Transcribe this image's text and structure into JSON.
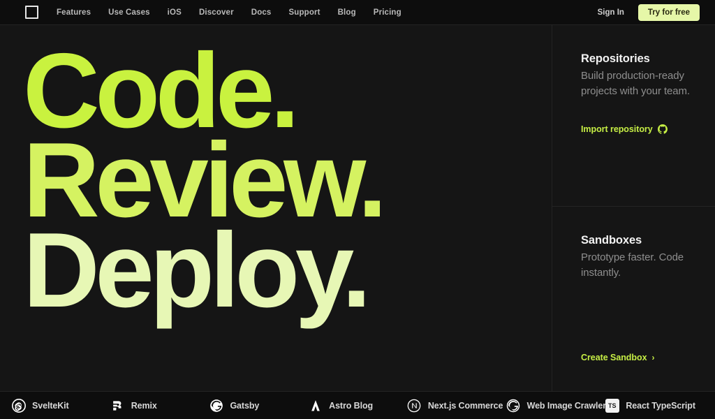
{
  "navbar": {
    "logo_icon": "codesandbox-square-logo",
    "links": [
      {
        "label": "Features"
      },
      {
        "label": "Use Cases"
      },
      {
        "label": "iOS"
      },
      {
        "label": "Discover"
      },
      {
        "label": "Docs"
      },
      {
        "label": "Support"
      },
      {
        "label": "Blog"
      },
      {
        "label": "Pricing"
      }
    ],
    "sign_in_label": "Sign In",
    "try_free_label": "Try for free"
  },
  "hero": {
    "headline_lines": [
      "Code.",
      "Review.",
      "Deploy."
    ],
    "colors": {
      "line_1": "#C9F23F",
      "line_2": "#D5F261",
      "line_3": "#E7F7B5",
      "background": "#151515"
    }
  },
  "rail": {
    "cards": [
      {
        "title": "Repositories",
        "description": "Build production-ready projects with your team.",
        "action_label": "Import repository",
        "action_icon": "github-icon"
      },
      {
        "title": "Sandboxes",
        "description": "Prototype faster. Code instantly.",
        "action_label": "Create Sandbox",
        "action_icon": "chevron-right-icon"
      }
    ],
    "accent_color": "#C6EE45"
  },
  "logo_strip": {
    "items": [
      {
        "label": "SvelteKit",
        "icon": "sveltekit-icon"
      },
      {
        "label": "Remix",
        "icon": "remix-icon"
      },
      {
        "label": "Gatsby",
        "icon": "gatsby-icon"
      },
      {
        "label": "Astro Blog",
        "icon": "astro-icon"
      },
      {
        "label": "Next.js Commerce",
        "icon": "nextjs-icon"
      },
      {
        "label": "Web Image Crawler",
        "icon": "gatsby-icon"
      },
      {
        "label": "React TypeScript",
        "icon": "typescript-icon"
      }
    ]
  }
}
